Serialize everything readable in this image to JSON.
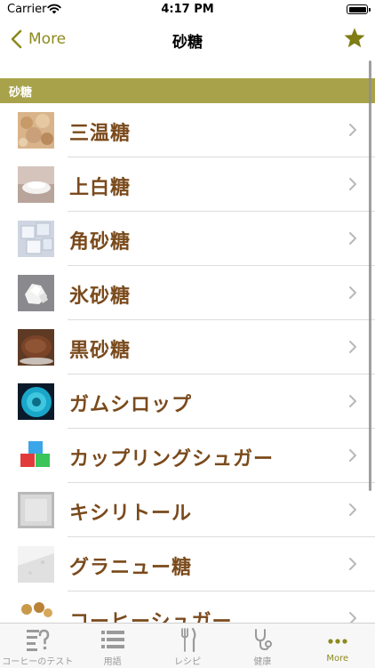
{
  "status_bar": {
    "carrier": "Carrier",
    "time": "4:17 PM"
  },
  "nav": {
    "back_label": "More",
    "title": "砂糖"
  },
  "section": {
    "title": "砂糖"
  },
  "items": [
    {
      "label": "三温糖",
      "thumb": "sanontou-photo"
    },
    {
      "label": "上白糖",
      "thumb": "joohakutou-photo"
    },
    {
      "label": "角砂糖",
      "thumb": "sugar-cube-photo"
    },
    {
      "label": "氷砂糖",
      "thumb": "rock-sugar-photo"
    },
    {
      "label": "黒砂糖",
      "thumb": "brown-sugar-photo"
    },
    {
      "label": "ガムシロップ",
      "thumb": "gum-syrup-photo"
    },
    {
      "label": "カップリングシュガー",
      "thumb": "coupling-sugar-photo"
    },
    {
      "label": "キシリトール",
      "thumb": "xylitol-photo"
    },
    {
      "label": "グラニュー糖",
      "thumb": "granulated-sugar-photo"
    },
    {
      "label": "コーヒーシュガー",
      "thumb": "coffee-sugar-photo"
    }
  ],
  "tabs": [
    {
      "label": "コーヒーのテスト",
      "icon": "quiz-icon",
      "active": false
    },
    {
      "label": "用語",
      "icon": "list-icon",
      "active": false
    },
    {
      "label": "レシピ",
      "icon": "fork-knife-icon",
      "active": false
    },
    {
      "label": "健康",
      "icon": "stethoscope-icon",
      "active": false
    },
    {
      "label": "More",
      "icon": "more-dots-icon",
      "active": true
    }
  ],
  "colors": {
    "accent": "#8c8a1e",
    "section_bg": "#a8a34a",
    "item_text": "#7a4a1c"
  }
}
